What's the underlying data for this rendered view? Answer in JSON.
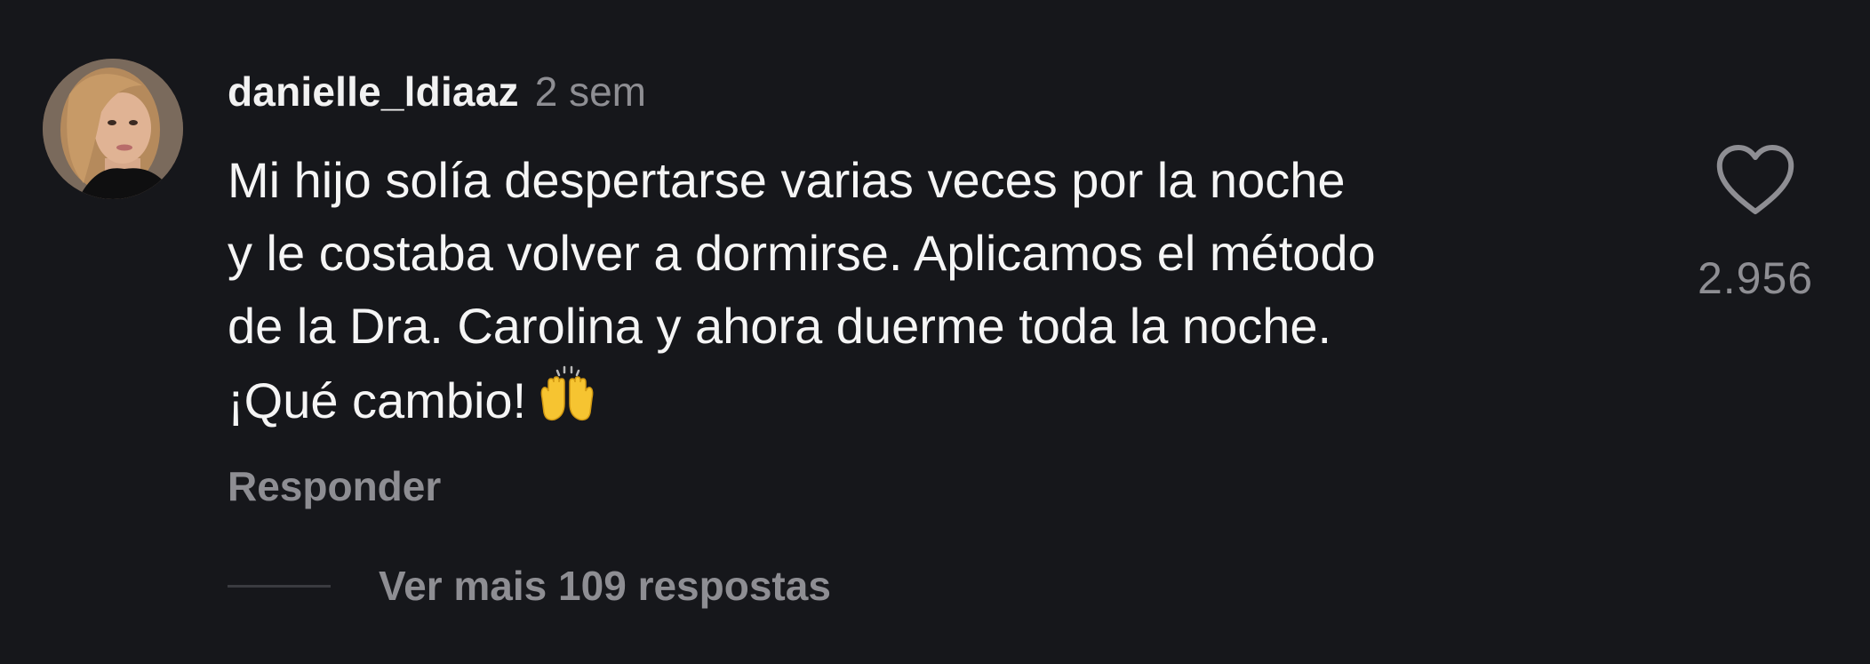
{
  "comment": {
    "username": "danielle_ldiaaz",
    "time_ago": "2 sem",
    "text_lines": [
      "Mi hijo solía despertarse varias veces por la noche",
      "y le costaba volver a dormirse. Aplicamos el método",
      "de la Dra. Carolina y ahora duerme toda la noche.",
      "¡Qué cambio!"
    ],
    "emoji": "raising-hands-icon",
    "reply_label": "Responder",
    "like_count": "2.956",
    "more_replies_label": "Ver mais 109 respostas"
  },
  "colors": {
    "background": "#16171b",
    "primary_text": "#f5f5f5",
    "secondary_text": "#8e8e93",
    "divider": "#3a3b40"
  }
}
